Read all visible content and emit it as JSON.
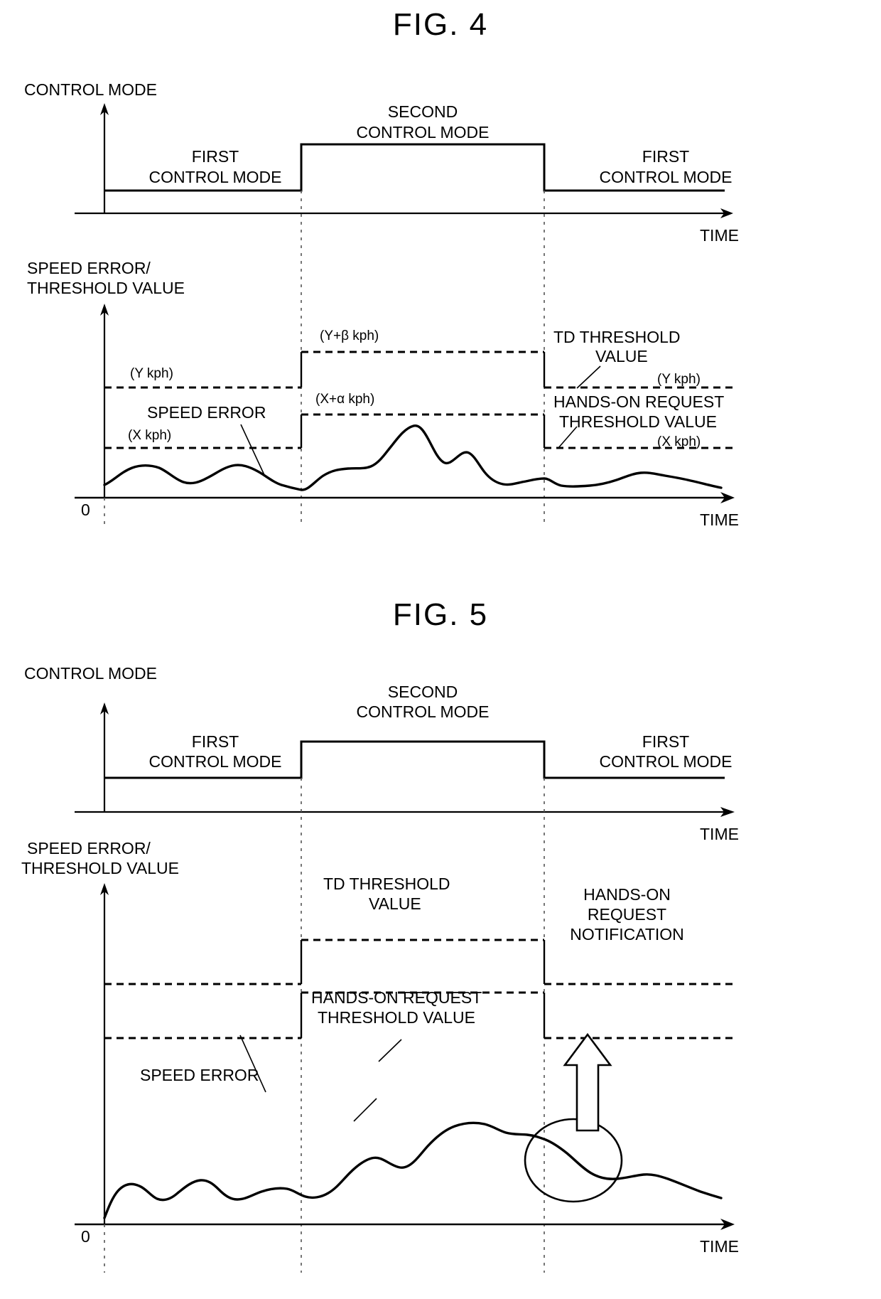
{
  "document": {
    "type": "patent-figure-sheet",
    "figures": [
      "FIG. 4",
      "FIG. 5"
    ]
  },
  "fig4": {
    "title": "FIG. 4",
    "upper_chart": {
      "y_axis_label": "CONTROL MODE",
      "x_axis_label": "TIME",
      "segment_labels": {
        "first_left_line1": "FIRST",
        "first_left_line2": "CONTROL MODE",
        "second_line1": "SECOND",
        "second_line2": "CONTROL MODE",
        "first_right_line1": "FIRST",
        "first_right_line2": "CONTROL MODE"
      }
    },
    "lower_chart": {
      "y_axis_label_line1": "SPEED ERROR/",
      "y_axis_label_line2": "THRESHOLD VALUE",
      "x_axis_label": "TIME",
      "origin_label": "0",
      "series_label": "SPEED ERROR",
      "annotations": {
        "y_kph_left": "(Y kph)",
        "x_kph_left": "(X kph)",
        "y_plus_beta": "(Y+β kph)",
        "x_plus_alpha": "(X+α kph)",
        "td_threshold_line1": "TD THRESHOLD",
        "td_threshold_line2": "VALUE",
        "y_kph_right": "(Y kph)",
        "hands_on_line1": "HANDS-ON REQUEST",
        "hands_on_line2": "THRESHOLD VALUE",
        "x_kph_right": "(X kph)"
      }
    }
  },
  "fig5": {
    "title": "FIG. 5",
    "upper_chart": {
      "y_axis_label": "CONTROL MODE",
      "x_axis_label": "TIME",
      "segment_labels": {
        "first_left_line1": "FIRST",
        "first_left_line2": "CONTROL MODE",
        "second_line1": "SECOND",
        "second_line2": "CONTROL MODE",
        "first_right_line1": "FIRST",
        "first_right_line2": "CONTROL MODE"
      }
    },
    "lower_chart": {
      "y_axis_label_line1": "SPEED ERROR/",
      "y_axis_label_line2": "THRESHOLD VALUE",
      "x_axis_label": "TIME",
      "origin_label": "0",
      "series_label": "SPEED ERROR",
      "annotations": {
        "td_threshold_line1": "TD THRESHOLD",
        "td_threshold_line2": "VALUE",
        "hands_on_line1": "HANDS-ON REQUEST",
        "hands_on_line2": "THRESHOLD VALUE",
        "notification_line1": "HANDS-ON",
        "notification_line2": "REQUEST",
        "notification_line3": "NOTIFICATION"
      }
    }
  },
  "chart_data": [
    {
      "id": "fig4-upper",
      "type": "line",
      "title": "FIG. 4 upper: control mode vs time",
      "xlabel": "TIME",
      "ylabel": "CONTROL MODE",
      "grid": false,
      "legend": "none",
      "x": [
        0,
        0.33,
        0.33,
        0.69,
        0.69,
        1.0
      ],
      "values": [
        1,
        1,
        2,
        2,
        1,
        1
      ],
      "state_labels": [
        "FIRST CONTROL MODE",
        "SECOND CONTROL MODE",
        "FIRST CONTROL MODE"
      ],
      "transitions_x": [
        0.33,
        0.69
      ]
    },
    {
      "id": "fig4-lower",
      "type": "line",
      "title": "FIG. 4 lower: speed error / threshold value vs time",
      "xlabel": "TIME",
      "ylabel": "SPEED ERROR/THRESHOLD VALUE",
      "grid": false,
      "legend": "none",
      "ylim": [
        0,
        10
      ],
      "series": [
        {
          "name": "SPEED ERROR",
          "x": [
            0.0,
            0.03,
            0.07,
            0.11,
            0.15,
            0.19,
            0.23,
            0.27,
            0.31,
            0.33,
            0.36,
            0.4,
            0.44,
            0.48,
            0.52,
            0.55,
            0.58,
            0.61,
            0.64,
            0.67,
            0.69,
            0.72,
            0.76,
            0.8,
            0.84,
            0.88,
            0.92,
            0.96,
            1.0
          ],
          "values": [
            1.0,
            1.35,
            1.9,
            1.45,
            1.05,
            1.5,
            1.95,
            1.5,
            1.0,
            0.9,
            1.65,
            2.0,
            2.1,
            2.9,
            4.3,
            3.6,
            2.9,
            3.3,
            2.4,
            1.9,
            2.0,
            1.5,
            1.45,
            1.5,
            1.75,
            2.0,
            1.95,
            1.8,
            1.5
          ]
        }
      ],
      "threshold_steps": [
        {
          "name": "TD THRESHOLD VALUE",
          "style": "dashed",
          "segments": [
            {
              "x0": 0.0,
              "x1": 0.33,
              "y": 6.2,
              "label": "(Y kph)"
            },
            {
              "x0": 0.33,
              "x1": 0.69,
              "y": 7.6,
              "label": "(Y+β kph)"
            },
            {
              "x0": 0.69,
              "x1": 1.0,
              "y": 6.2,
              "label": "(Y kph)"
            }
          ]
        },
        {
          "name": "HANDS-ON REQUEST THRESHOLD VALUE",
          "style": "dashed",
          "segments": [
            {
              "x0": 0.0,
              "x1": 0.33,
              "y": 4.2,
              "label": "(X kph)"
            },
            {
              "x0": 0.33,
              "x1": 0.69,
              "y": 5.4,
              "label": "(X+α kph)"
            },
            {
              "x0": 0.69,
              "x1": 1.0,
              "y": 4.2,
              "label": "(X kph)"
            }
          ]
        }
      ]
    },
    {
      "id": "fig5-upper",
      "type": "line",
      "title": "FIG. 5 upper: control mode vs time",
      "xlabel": "TIME",
      "ylabel": "CONTROL MODE",
      "grid": false,
      "legend": "none",
      "x": [
        0,
        0.33,
        0.33,
        0.69,
        0.69,
        1.0
      ],
      "values": [
        1,
        1,
        2,
        2,
        1,
        1
      ],
      "state_labels": [
        "FIRST CONTROL MODE",
        "SECOND CONTROL MODE",
        "FIRST CONTROL MODE"
      ],
      "transitions_x": [
        0.33,
        0.69
      ]
    },
    {
      "id": "fig5-lower",
      "type": "line",
      "title": "FIG. 5 lower: speed error / threshold value vs time",
      "xlabel": "TIME",
      "ylabel": "SPEED ERROR/THRESHOLD VALUE",
      "grid": false,
      "legend": "none",
      "ylim": [
        0,
        10
      ],
      "series": [
        {
          "name": "SPEED ERROR",
          "x": [
            0.0,
            0.02,
            0.05,
            0.09,
            0.13,
            0.17,
            0.21,
            0.25,
            0.29,
            0.33,
            0.37,
            0.41,
            0.45,
            0.49,
            0.53,
            0.57,
            0.61,
            0.65,
            0.69,
            0.73,
            0.77,
            0.81,
            0.85,
            0.9,
            0.95,
            1.0
          ],
          "values": [
            0.6,
            1.25,
            1.6,
            1.35,
            1.5,
            1.65,
            1.45,
            1.55,
            1.5,
            1.35,
            1.4,
            1.9,
            2.3,
            2.2,
            2.7,
            3.2,
            3.5,
            3.45,
            3.3,
            3.15,
            2.4,
            2.0,
            1.9,
            1.95,
            1.8,
            1.55
          ]
        }
      ],
      "threshold_steps": [
        {
          "name": "TD THRESHOLD VALUE",
          "style": "dashed",
          "segments": [
            {
              "x0": 0.0,
              "x1": 0.33,
              "y": 4.6,
              "label": ""
            },
            {
              "x0": 0.33,
              "x1": 0.69,
              "y": 6.3,
              "label": ""
            },
            {
              "x0": 0.69,
              "x1": 1.0,
              "y": 4.6,
              "label": ""
            }
          ]
        },
        {
          "name": "HANDS-ON REQUEST THRESHOLD VALUE",
          "style": "dashed",
          "segments": [
            {
              "x0": 0.0,
              "x1": 0.33,
              "y": 2.6,
              "label": ""
            },
            {
              "x0": 0.33,
              "x1": 0.69,
              "y": 4.3,
              "label": ""
            },
            {
              "x0": 0.69,
              "x1": 1.0,
              "y": 2.6,
              "label": ""
            }
          ]
        }
      ],
      "annotations": [
        {
          "type": "ellipse",
          "name": "crossing-highlight",
          "x": 0.73,
          "y": 3.0
        },
        {
          "type": "arrow",
          "name": "hands-on-request-notification-arrow",
          "direction": "up",
          "x": 0.77
        },
        {
          "type": "text",
          "name": "notification-label",
          "text": "HANDS-ON REQUEST NOTIFICATION"
        }
      ]
    }
  ]
}
